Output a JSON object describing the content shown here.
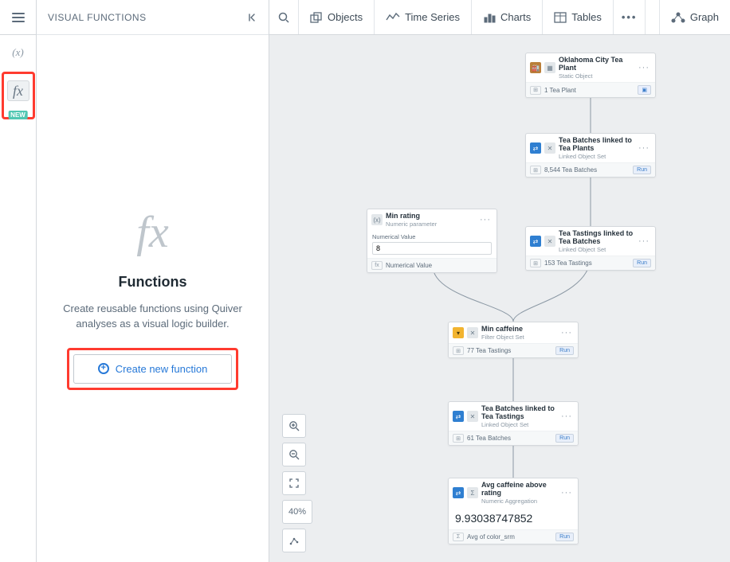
{
  "sidebar": {
    "header": "VISUAL FUNCTIONS",
    "title": "Functions",
    "description": "Create reusable functions using Quiver analyses as a visual logic builder.",
    "create_label": "Create new function",
    "new_badge": "NEW"
  },
  "toolbar": {
    "objects": "Objects",
    "time_series": "Time Series",
    "charts": "Charts",
    "tables": "Tables",
    "graph": "Graph"
  },
  "canvas_controls": {
    "zoom_pct": "40%"
  },
  "nodes": {
    "n1": {
      "title": "Oklahoma City Tea Plant",
      "subtitle": "Static Object",
      "footer": "1 Tea Plant"
    },
    "n2": {
      "title": "Tea Batches linked to Tea Plants",
      "subtitle": "Linked Object Set",
      "footer": "8,544 Tea Batches",
      "run": "Run"
    },
    "n3": {
      "title": "Tea Tastings linked to Tea Batches",
      "subtitle": "Linked Object Set",
      "footer": "153 Tea Tastings",
      "run": "Run"
    },
    "n4": {
      "title": "Min rating",
      "subtitle": "Numeric parameter",
      "field_label": "Numerical Value",
      "field_value": "8",
      "footer": "Numerical Value"
    },
    "n5": {
      "title": "Min caffeine",
      "subtitle": "Filter Object Set",
      "footer": "77 Tea Tastings",
      "run": "Run"
    },
    "n6": {
      "title": "Tea Batches linked to Tea Tastings",
      "subtitle": "Linked Object Set",
      "footer": "61 Tea Batches",
      "run": "Run"
    },
    "n7": {
      "title": "Avg caffeine above rating",
      "subtitle": "Numeric Aggregation",
      "value": "9.93038747852",
      "footer": "Avg of color_srm",
      "run": "Run"
    }
  }
}
